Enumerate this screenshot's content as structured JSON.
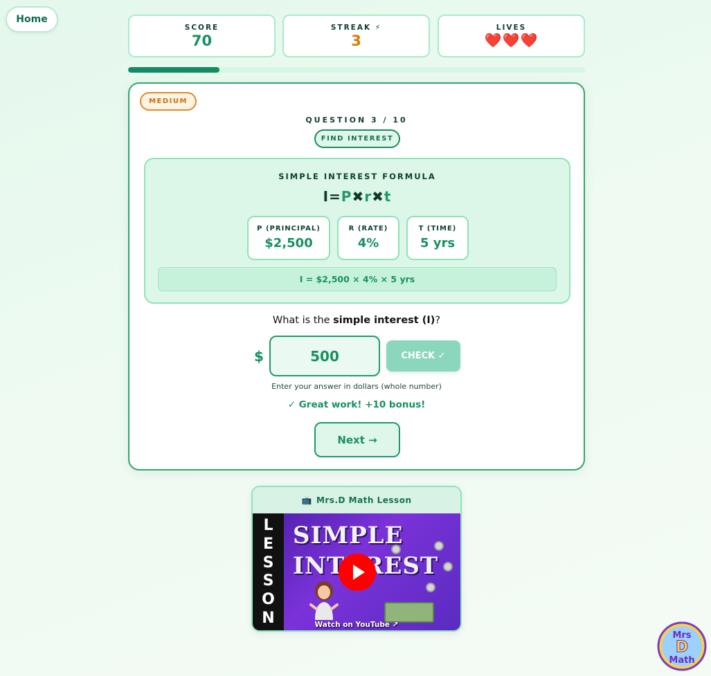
{
  "nav": {
    "home_label": "Home"
  },
  "stats": {
    "score_label": "SCORE",
    "score_value": "70",
    "streak_label": "STREAK ⚡",
    "streak_value": "3",
    "lives_label": "LIVES",
    "lives_value": "❤️❤️❤️"
  },
  "progress": {
    "fraction": 0.2
  },
  "quiz": {
    "difficulty": "MEDIUM",
    "question_counter": "QUESTION 3 / 10",
    "type": "FIND INTEREST",
    "formula": {
      "title": "SIMPLE INTEREST FORMULA",
      "eq_i": "I",
      "eq_eq": "=",
      "eq_p": "P",
      "eq_x1": "✖",
      "eq_r": "r",
      "eq_x2": "✖",
      "eq_t": "t",
      "principal_label": "P (PRINCIPAL)",
      "principal_value": "$2,500",
      "rate_label": "R (RATE)",
      "rate_value": "4%",
      "time_label": "T (TIME)",
      "time_value": "5 yrs",
      "substitution": "I = $2,500 × 4% × 5 yrs"
    },
    "question_prefix": "What is the ",
    "question_bold": "simple interest (I)",
    "question_suffix": "?",
    "currency": "$",
    "answer_value": "500",
    "check_label": "CHECK ✓",
    "hint": "Enter your answer in dollars (whole number)",
    "feedback": "✓ Great work! +10 bonus!",
    "next_label": "Next →"
  },
  "video": {
    "header_icon": "📺",
    "header_title": "Mrs.D Math Lesson",
    "thumb_side": [
      "L",
      "E",
      "S",
      "S",
      "O",
      "N"
    ],
    "thumb_title_1": "SIMPLE",
    "thumb_title_2": "INTEREST",
    "watch_label": "Watch on YouTube ↗"
  },
  "colors": {
    "accent": "#17915f",
    "streak": "#d77a08",
    "card_border": "#2ea86b",
    "check_button": "#8bd7be",
    "play_button": "#ff0000"
  },
  "icons": {
    "streak": "lightning-icon",
    "lives": "heart-icon",
    "video": "tv-icon",
    "play": "play-icon",
    "external": "external-link-icon"
  },
  "logo": {
    "line1": "Mrs",
    "line2": "D",
    "line3": "Math"
  }
}
